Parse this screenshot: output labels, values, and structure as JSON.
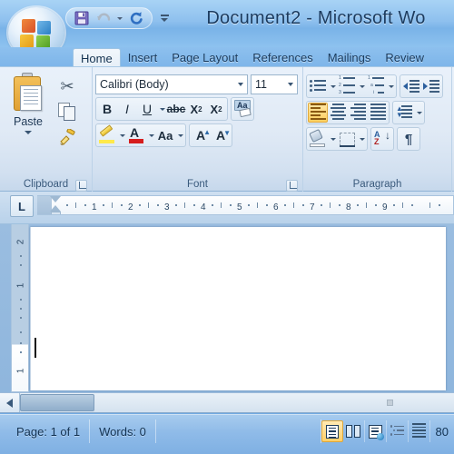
{
  "window": {
    "title": "Document2 - Microsoft Wo",
    "office_button": "office-orb"
  },
  "quick_access": {
    "items": [
      {
        "name": "save",
        "label": "Save",
        "glyph": "save-icon"
      },
      {
        "name": "undo",
        "label": "Undo",
        "glyph": "undo-icon",
        "enabled": false
      },
      {
        "name": "redo",
        "label": "Repeat",
        "glyph": "redo-icon",
        "enabled": true
      }
    ],
    "customize_label": "Customize Quick Access Toolbar"
  },
  "tabs": [
    {
      "label": "Home",
      "active": true
    },
    {
      "label": "Insert",
      "active": false
    },
    {
      "label": "Page Layout",
      "active": false
    },
    {
      "label": "References",
      "active": false
    },
    {
      "label": "Mailings",
      "active": false
    },
    {
      "label": "Review",
      "active": false
    }
  ],
  "ribbon": {
    "clipboard": {
      "label": "Clipboard",
      "paste_label": "Paste",
      "cut_label": "Cut",
      "copy_label": "Copy",
      "format_painter_label": "Format Painter",
      "dialog_launcher_label": "Clipboard"
    },
    "font": {
      "label": "Font",
      "font_name": "Calibri (Body)",
      "font_size": "11",
      "bold_label": "B",
      "italic_label": "I",
      "underline_label": "U",
      "strikethrough_label": "abc",
      "subscript_label": "X",
      "subscript_sub": "2",
      "superscript_label": "X",
      "superscript_sup": "2",
      "clear_formatting_label": "Aa",
      "highlight_label": "Text Highlight Color",
      "font_color_label": "A",
      "change_case_label": "Aa",
      "grow_font_label": "A",
      "shrink_font_label": "A",
      "dialog_launcher_label": "Font"
    },
    "paragraph": {
      "label": "Paragraph",
      "bullets_label": "Bullets",
      "numbering_label": "Numbering",
      "multilevel_label": "Multilevel List",
      "decrease_indent_label": "Decrease Indent",
      "increase_indent_label": "Increase Indent",
      "align_left_label": "Align Text Left",
      "align_center_label": "Center",
      "align_right_label": "Align Text Right",
      "justify_label": "Justify",
      "line_spacing_label": "Line Spacing",
      "shading_label": "Shading",
      "borders_label": "Borders",
      "sort_label": "Sort",
      "sort_a": "A",
      "sort_z": "Z",
      "show_marks_label": "¶",
      "dialog_launcher_label": "Paragraph"
    }
  },
  "ruler": {
    "tab_selector": "L",
    "horizontal_ticks": [
      "1",
      "2",
      "3",
      "4",
      "5",
      "6",
      "7",
      "8",
      "9"
    ],
    "vertical_ticks": [
      "2",
      "1",
      "1"
    ]
  },
  "document": {
    "page_content": "",
    "caret_visible": true
  },
  "scrollbar": {
    "horizontal_left_label": "Scroll Left",
    "split_handle_label": "Split"
  },
  "status_bar": {
    "page": "Page: 1 of 1",
    "words": "Words: 0",
    "views": [
      {
        "name": "print-layout",
        "label": "Print Layout",
        "selected": true
      },
      {
        "name": "full-screen-reading",
        "label": "Full Screen Reading",
        "selected": false
      },
      {
        "name": "web-layout",
        "label": "Web Layout",
        "selected": false
      },
      {
        "name": "outline",
        "label": "Outline",
        "selected": false
      },
      {
        "name": "draft",
        "label": "Draft",
        "selected": false
      }
    ],
    "zoom": "80"
  },
  "colors": {
    "titlebar_blue": "#8ec0ee",
    "ribbon_bg": "#dfe9f5",
    "accent_orange": "#ffcf5e",
    "font_color_red": "#d61d1d",
    "highlight_yellow": "#ffe94a",
    "page_white": "#ffffff",
    "desk_blue": "#9abde0"
  }
}
